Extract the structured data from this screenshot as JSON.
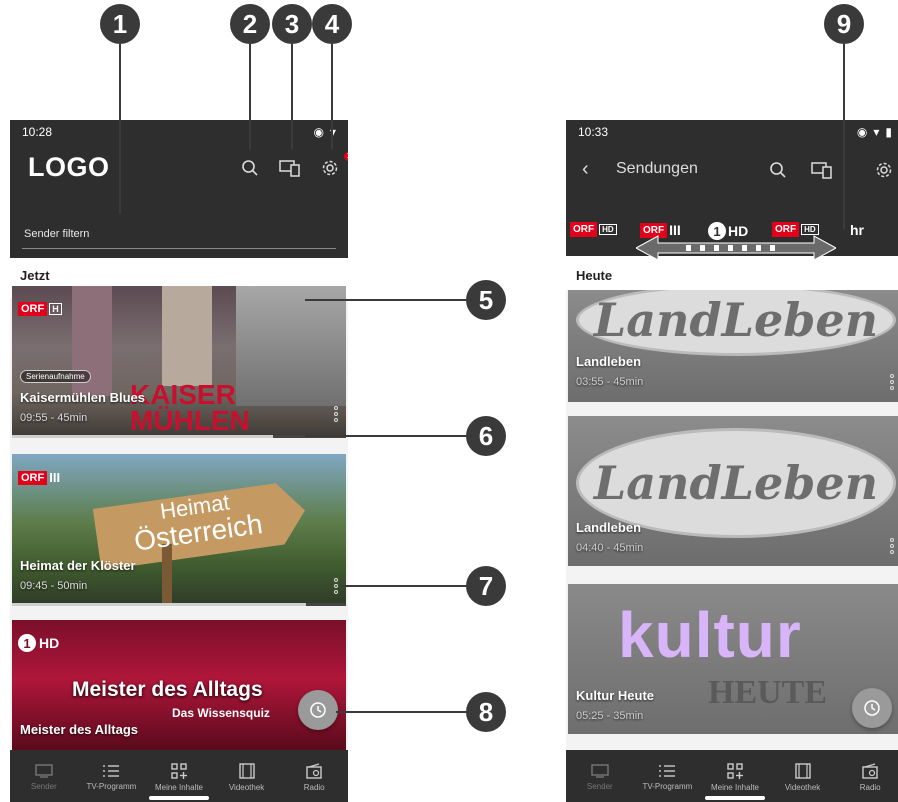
{
  "callouts": [
    "1",
    "2",
    "3",
    "4",
    "5",
    "6",
    "7",
    "8",
    "9"
  ],
  "left_phone": {
    "status_time": "10:28",
    "logo": "LOGO",
    "notification_count": "1",
    "filter_label": "Sender filtern",
    "section_title": "Jetzt",
    "cards": [
      {
        "badge": "Serienaufnahme",
        "title": "Kaisermühlen Blues",
        "meta": "09:55 - 45min",
        "overlay_text": [
          "KAISER",
          "MÜHLEN"
        ],
        "channel": "ORF",
        "channel_sub": "H",
        "progress": 0.78
      },
      {
        "title": "Heimat der Klöster",
        "meta": "09:45 - 50min",
        "overlay_text": [
          "Heimat",
          "Österreich"
        ],
        "channel": "ORF",
        "channel_sub": "III",
        "progress": 0.88
      },
      {
        "title": "Meister des Alltags",
        "meta": "",
        "overlay_text": [
          "Meister des Alltags",
          "Das Wissensquiz"
        ],
        "channel": "HD"
      }
    ],
    "nav": [
      "Sender",
      "TV-Programm",
      "Meine Inhalte",
      "Videothek",
      "Radio"
    ]
  },
  "right_phone": {
    "status_time": "10:33",
    "title": "Sendungen",
    "channels": [
      {
        "red": "ORF",
        "sub": "HD"
      },
      {
        "red": "ORF",
        "sub": "III"
      },
      {
        "white": "HD"
      },
      {
        "red": "ORF",
        "sub": "HD"
      },
      {
        "white": "hr"
      }
    ],
    "section_title": "Heute",
    "cards": [
      {
        "logo_text": "LandLeben",
        "title": "Landleben",
        "meta": "03:55 - 45min"
      },
      {
        "logo_text": "LandLeben",
        "title": "Landleben",
        "meta": "04:40 - 45min"
      },
      {
        "logo_text": "kultur",
        "logo_text2": "HEUTE",
        "title": "Kultur Heute",
        "meta": "05:25 - 35min"
      }
    ],
    "nav": [
      "Sender",
      "TV-Programm",
      "Meine Inhalte",
      "Videothek",
      "Radio"
    ]
  }
}
